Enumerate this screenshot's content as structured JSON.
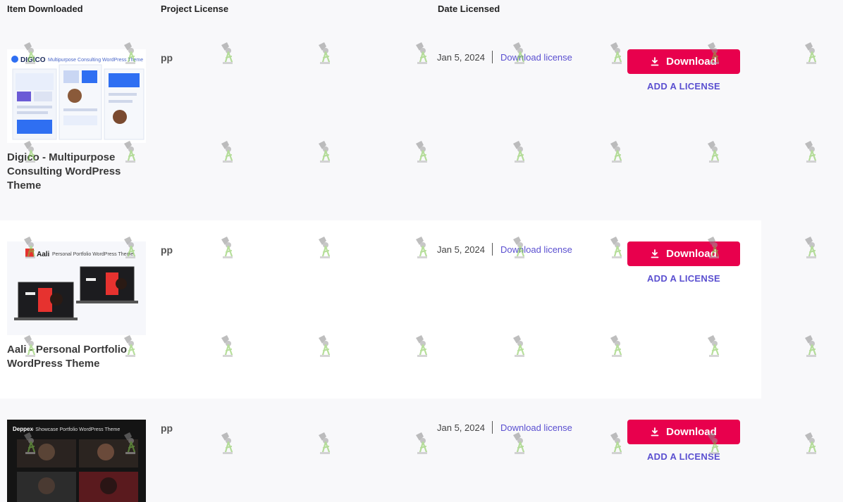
{
  "table": {
    "headers": {
      "item": "Item Downloaded",
      "license": "Project License",
      "date": "Date Licensed"
    }
  },
  "rows": [
    {
      "thumb_brand": "DIGICO",
      "thumb_caption": "Multipurpose Consulting WordPress Theme",
      "title": "Digico - Multipurpose Consulting WordPress Theme",
      "license": "pp",
      "date": "Jan 5, 2024",
      "download_link": "Download license",
      "download_button": "Download",
      "add_license": "ADD A LICENSE"
    },
    {
      "thumb_brand": "Aali",
      "thumb_caption": "Personal Portfolio WordPress Theme",
      "title": "Aali - Personal Portfolio WordPress Theme",
      "license": "pp",
      "date": "Jan 5, 2024",
      "download_link": "Download license",
      "download_button": "Download",
      "add_license": "ADD A LICENSE"
    },
    {
      "thumb_brand": "Deppex",
      "thumb_caption": "- Showcase Portfolio WordPress Theme",
      "title": "",
      "license": "pp",
      "date": "Jan 5, 2024",
      "download_link": "Download license",
      "download_button": "Download",
      "add_license": "ADD A LICENSE"
    }
  ],
  "colors": {
    "accent": "#e8004d",
    "link": "#5a4fd0",
    "row_bg": "#f8f8fa",
    "row_alt_bg": "#ffffff"
  },
  "icons": {
    "download": "download-icon",
    "watermark": "watermark-icon"
  }
}
